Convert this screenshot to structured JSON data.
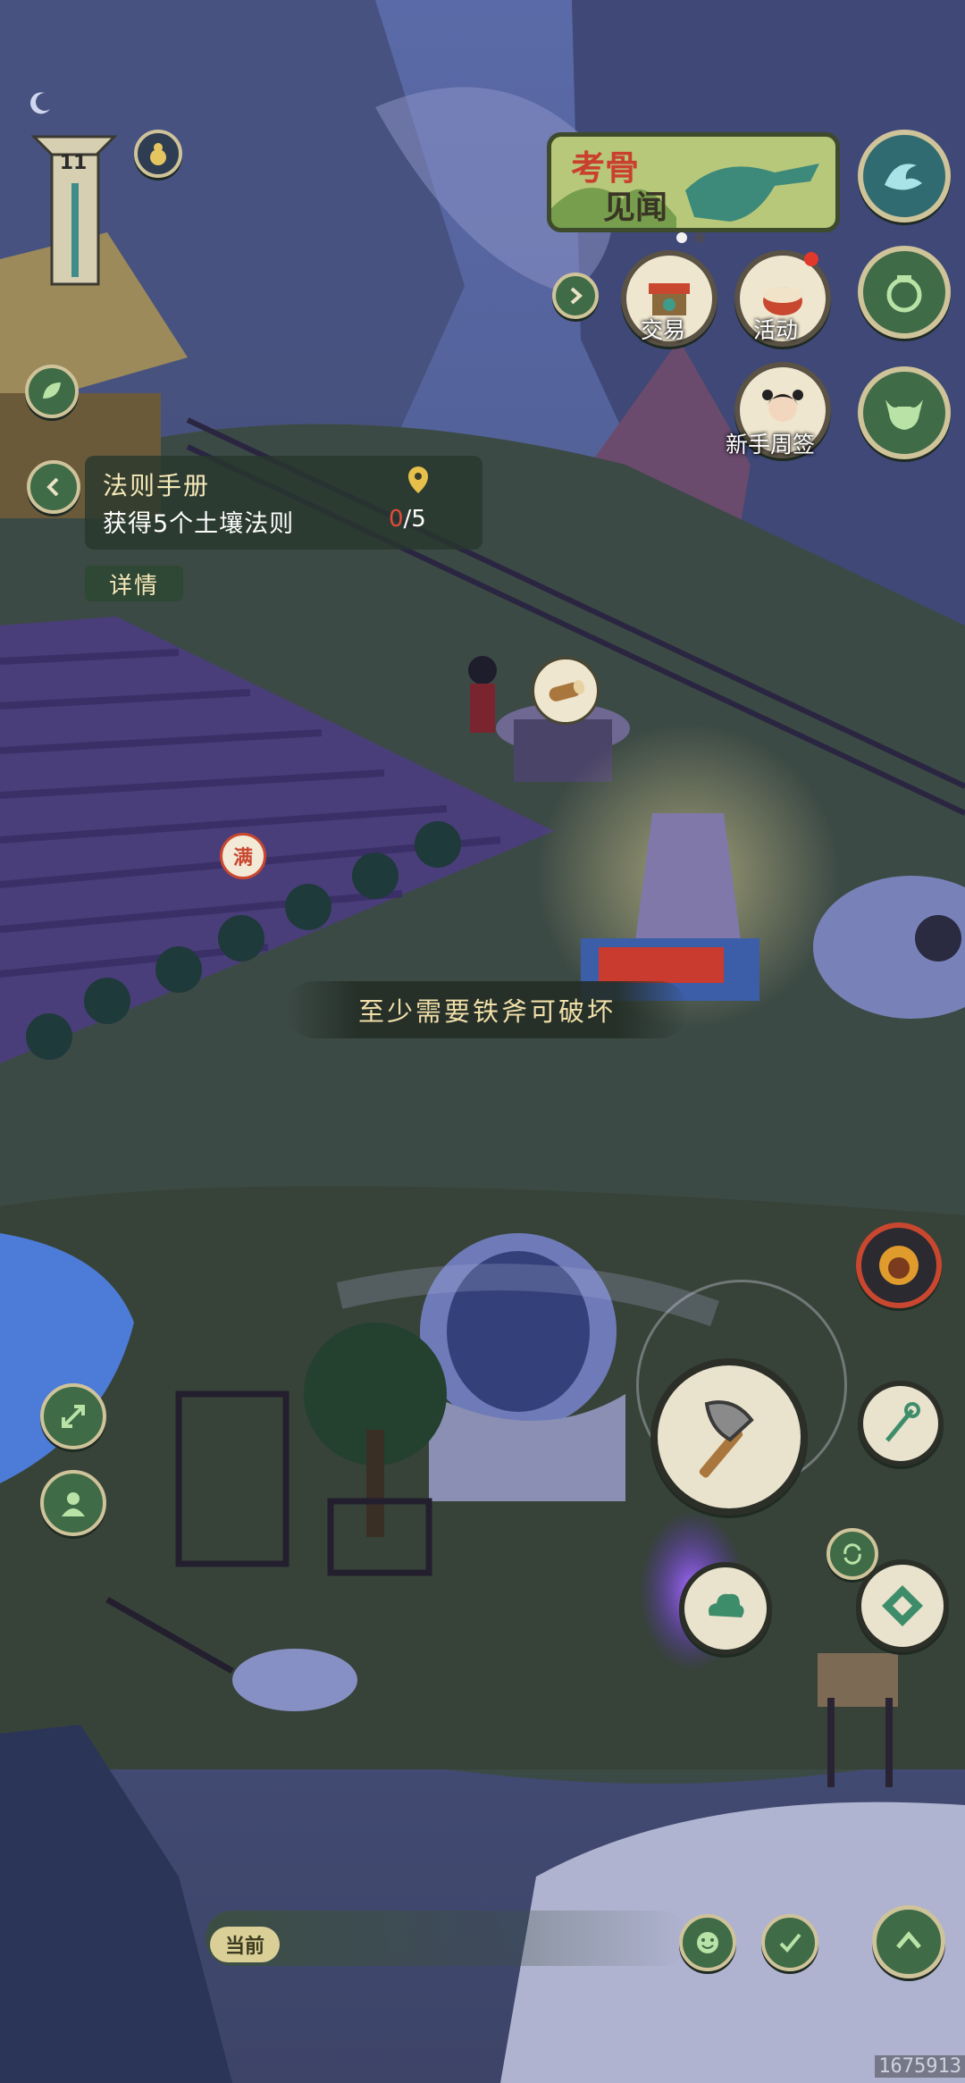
{
  "hud": {
    "level": "11"
  },
  "event_banner": {
    "title_line1": "考骨",
    "title_line2": "见闻"
  },
  "features": {
    "trade": "交易",
    "activity": "活动",
    "newbie_sign": "新手周签"
  },
  "quest": {
    "title": "法则手册",
    "description": "获得5个土壤法则",
    "progress_current": "0",
    "progress_total": "/5",
    "details_label": "详情"
  },
  "hint_text": "至少需要铁斧可破坏",
  "field_badge": "满",
  "chat": {
    "current_label": "当前"
  },
  "watermark": "1675913",
  "icons": {
    "moon": "moon-icon",
    "gourd": "gourd-icon",
    "wave": "wave-skill-icon",
    "bag": "bag-icon",
    "ox": "ox-mount-icon",
    "expand": "expand-icon",
    "character": "character-icon",
    "hero": "hero-portrait-icon",
    "axe": "axe-action-icon",
    "spear": "staff-tool-icon",
    "cloud": "cloud-skill-icon",
    "switch": "switch-icon",
    "compass": "compass-icon",
    "emoji": "emoji-icon",
    "check": "task-check-icon",
    "up": "arrow-up-icon"
  },
  "colors": {
    "button_green": "#3f6b47",
    "button_rim": "#cfc39a",
    "accent_red": "#e04b3a",
    "hint_text": "#f1dfa8"
  }
}
